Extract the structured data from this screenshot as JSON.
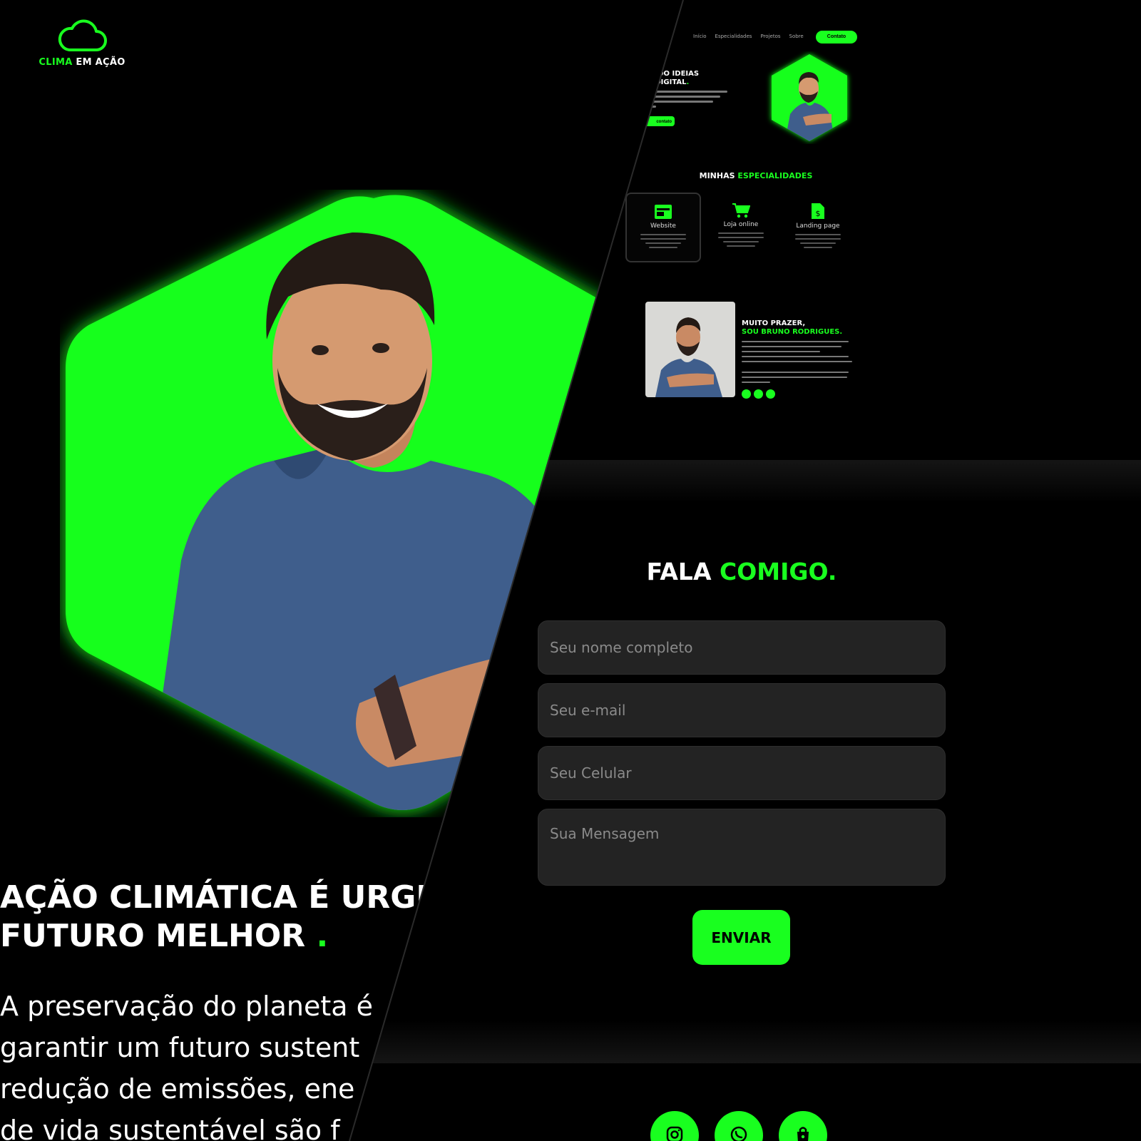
{
  "brand": {
    "name_accent": "CLIMA",
    "name_rest": "EM AÇÃO",
    "icon": "cloud-icon"
  },
  "hero": {
    "title_line1": "AÇÃO CLIMÁTICA É URGEN",
    "title_line2": "FUTURO MELHOR",
    "title_dot": ".",
    "text_lines": [
      "A preservação do planeta é",
      "garantir um futuro sustent",
      "redução de emissões, ene",
      "de vida sustentável são f"
    ]
  },
  "mini_site": {
    "nav": [
      "Início",
      "Especialidades",
      "Projetos",
      "Sobre"
    ],
    "cta": "Contato",
    "hero_title_line1": "ORMANDO IDEIAS",
    "hero_title_line2": "IDADE DIGITAL",
    "hero_title_dot": ".",
    "hero_button": "contato",
    "specialties_title": "MINHAS",
    "specialties_title_accent": "ESPECIALIDADES",
    "specialties": [
      {
        "label": "Website",
        "icon": "browser-icon"
      },
      {
        "label": "Loja online",
        "icon": "cart-icon"
      },
      {
        "label": "Landing page",
        "icon": "document-dollar-icon"
      }
    ],
    "about_title_line1": "MUITO PRAZER,",
    "about_title_line2": "SOU BRUNO RODRIGUES."
  },
  "contact": {
    "title": "FALA",
    "title_accent": "COMIGO.",
    "name_placeholder": "Seu nome completo",
    "email_placeholder": "Seu e-mail",
    "phone_placeholder": "Seu Celular",
    "message_placeholder": "Sua Mensagem",
    "send_label": "ENVIAR"
  },
  "footer": {
    "icons": [
      "instagram-icon",
      "whatsapp-icon",
      "shop-bag-icon"
    ]
  },
  "colors": {
    "accent": "#19ff1f",
    "background": "#000000",
    "field": "#232323"
  }
}
